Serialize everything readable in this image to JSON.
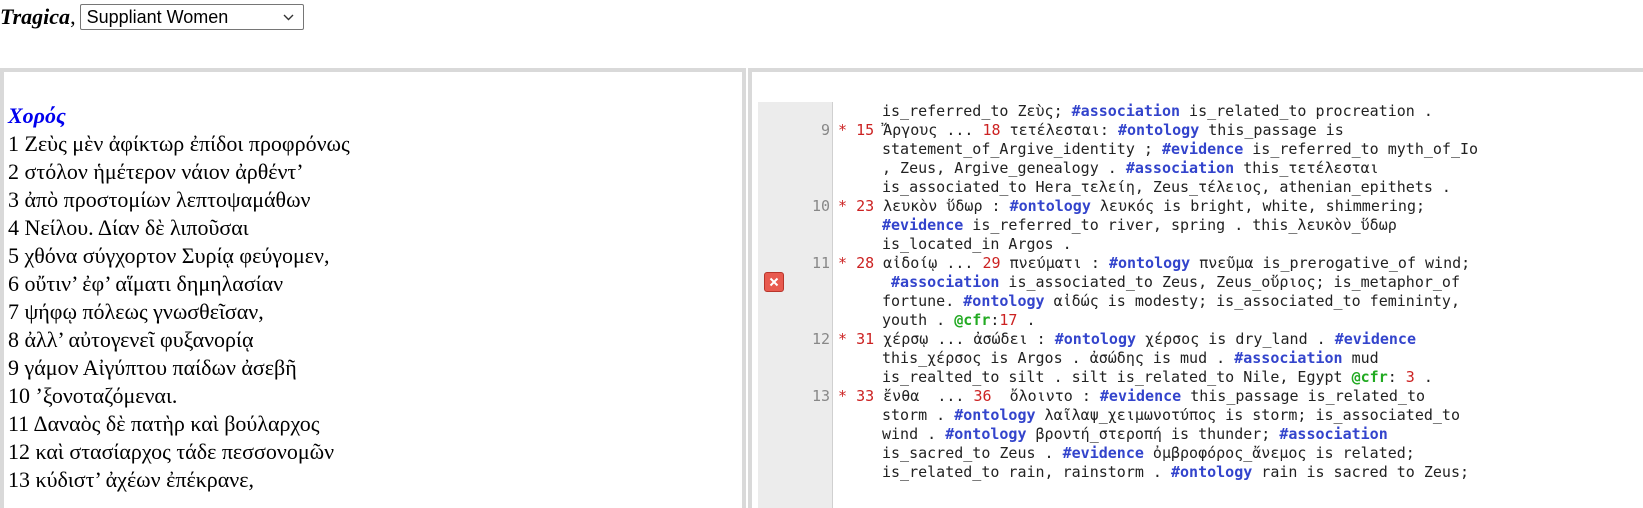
{
  "header": {
    "brand": "Tragica",
    "separator": ",",
    "select_value": "Suppliant Women"
  },
  "text_panel": {
    "speaker": "Χορός",
    "verses": [
      "1 Ζεὺς μὲν ἀφίκτωρ ἐπίδοι προφρόνως",
      "2 στόλον ἡμέτερον νάιον ἀρθέντ’",
      "3 ἀπὸ προστομίων λεπτοψαμάθων",
      "4 Νείλου. Δίαν δὲ λιποῦσαι",
      "5 χθόνα σύγχορτον Συρίᾳ φεύγομεν,",
      "6 οὔτιν’ ἐφ’ αἵματι δημηλασίαν",
      "7 ψήφῳ πόλεως γνωσθεῖσαν,",
      "8 ἀλλ’ αὐτογενεῖ φυξανορίᾳ",
      "9 γάμον Αἰγύπτου παίδων ἀσεβῆ",
      "10 ’ξονοταζόμεναι.",
      "11 Δαναὸς δὲ πατὴρ καὶ βούλαρχος",
      "12 καὶ στασίαρχος τάδε πεσσονομῶν",
      "13 κύδιστ’ ἀχέων ἐπέκρανε,"
    ]
  },
  "editor": {
    "line_numbers": [
      "9",
      "10",
      "11",
      "12",
      "13"
    ],
    "error_icon": "close-icon",
    "colors": {
      "keyword": "#3344cc",
      "verse_ref": "#cc2222",
      "cfr": "#22aa22",
      "gutter": "#ececec",
      "error": "#e85a4f"
    },
    "rows": [
      [
        {
          "t": "is_referred_to Ζεὺς; ",
          "c": ""
        },
        {
          "t": "#association",
          "c": "kw"
        },
        {
          "t": " is_related_to procreation .",
          "c": ""
        }
      ],
      [
        {
          "t": "* ",
          "c": "star"
        },
        {
          "t": "15",
          "c": "num"
        },
        {
          "t": " Ἄργους ... ",
          "c": ""
        },
        {
          "t": "18",
          "c": "num"
        },
        {
          "t": " τετέλεσται: ",
          "c": ""
        },
        {
          "t": "#ontology",
          "c": "kw"
        },
        {
          "t": " this_passage is",
          "c": ""
        }
      ],
      [
        {
          "t": "statement_of_Argive_identity ; ",
          "c": ""
        },
        {
          "t": "#evidence",
          "c": "kw"
        },
        {
          "t": " is_referred_to myth_of_Io",
          "c": ""
        }
      ],
      [
        {
          "t": ", Zeus, Argive_genealogy . ",
          "c": ""
        },
        {
          "t": "#association",
          "c": "kw"
        },
        {
          "t": " this_τετέλεσται",
          "c": ""
        }
      ],
      [
        {
          "t": "is_associated_to Hera_τελείη, Zeus_τέλειος, athenian_epithets .",
          "c": ""
        }
      ],
      [
        {
          "t": "* ",
          "c": "star"
        },
        {
          "t": "23",
          "c": "num"
        },
        {
          "t": " λευκὸν ὕδωρ : ",
          "c": ""
        },
        {
          "t": "#ontology",
          "c": "kw"
        },
        {
          "t": " λευκός is bright, white, shimmering;",
          "c": ""
        }
      ],
      [
        {
          "t": "#evidence",
          "c": "kw"
        },
        {
          "t": " is_referred_to river, spring . this_λευκὸν_ὕδωρ",
          "c": ""
        }
      ],
      [
        {
          "t": "is_located_in Argos .",
          "c": ""
        }
      ],
      [
        {
          "t": "* ",
          "c": "star"
        },
        {
          "t": "28",
          "c": "num"
        },
        {
          "t": " αἰδοίῳ ... ",
          "c": ""
        },
        {
          "t": "29",
          "c": "num"
        },
        {
          "t": " πνεύματι : ",
          "c": ""
        },
        {
          "t": "#ontology",
          "c": "kw"
        },
        {
          "t": " πνεῦμα is_prerogative_of wind;",
          "c": ""
        }
      ],
      [
        {
          "t": " ",
          "c": ""
        },
        {
          "t": "#association",
          "c": "kw"
        },
        {
          "t": " is_associated_to Zeus, Zeus_οὔριος; is_metaphor_of",
          "c": ""
        }
      ],
      [
        {
          "t": "fortune. ",
          "c": ""
        },
        {
          "t": "#ontology",
          "c": "kw"
        },
        {
          "t": " αἰδώς is modesty; is_associated_to femininty,",
          "c": ""
        }
      ],
      [
        {
          "t": "youth . ",
          "c": ""
        },
        {
          "t": "@cfr",
          "c": "cfr"
        },
        {
          "t": ":",
          "c": ""
        },
        {
          "t": "17",
          "c": "cnum"
        },
        {
          "t": " .",
          "c": ""
        }
      ],
      [
        {
          "t": "* ",
          "c": "star"
        },
        {
          "t": "31",
          "c": "num"
        },
        {
          "t": " χέρσῳ ... ἀσώδει : ",
          "c": ""
        },
        {
          "t": "#ontology",
          "c": "kw"
        },
        {
          "t": " χέρσος is dry_land . ",
          "c": ""
        },
        {
          "t": "#evidence",
          "c": "kw"
        }
      ],
      [
        {
          "t": "this_χέρσος is Argos . ἀσώδης is mud . ",
          "c": ""
        },
        {
          "t": "#association",
          "c": "kw"
        },
        {
          "t": " mud",
          "c": ""
        }
      ],
      [
        {
          "t": "is_realted_to silt . silt is_related_to Nile, Egypt ",
          "c": ""
        },
        {
          "t": "@cfr",
          "c": "cfr"
        },
        {
          "t": ": ",
          "c": ""
        },
        {
          "t": "3",
          "c": "cnum"
        },
        {
          "t": " .",
          "c": ""
        }
      ],
      [
        {
          "t": "* ",
          "c": "star"
        },
        {
          "t": "33",
          "c": "num"
        },
        {
          "t": " ἔνθα  ... ",
          "c": ""
        },
        {
          "t": "36",
          "c": "num"
        },
        {
          "t": "  ὄλοιντο : ",
          "c": ""
        },
        {
          "t": "#evidence",
          "c": "kw"
        },
        {
          "t": " this_passage is_related_to",
          "c": ""
        }
      ],
      [
        {
          "t": "storm . ",
          "c": ""
        },
        {
          "t": "#ontology",
          "c": "kw"
        },
        {
          "t": " λαῖλαψ_χειμωνοτύπος is storm; is_associated_to",
          "c": ""
        }
      ],
      [
        {
          "t": "wind . ",
          "c": ""
        },
        {
          "t": "#ontology",
          "c": "kw"
        },
        {
          "t": " βροντή_στεροπή is thunder; ",
          "c": ""
        },
        {
          "t": "#association",
          "c": "kw"
        }
      ],
      [
        {
          "t": "is_sacred_to Zeus . ",
          "c": ""
        },
        {
          "t": "#evidence",
          "c": "kw"
        },
        {
          "t": " ὀμβροφόρος_ἄνεμος is related;",
          "c": ""
        }
      ],
      [
        {
          "t": "is_related_to rain, rainstorm . ",
          "c": ""
        },
        {
          "t": "#ontology",
          "c": "kw"
        },
        {
          "t": " rain is sacred to Zeus;",
          "c": ""
        }
      ]
    ]
  }
}
